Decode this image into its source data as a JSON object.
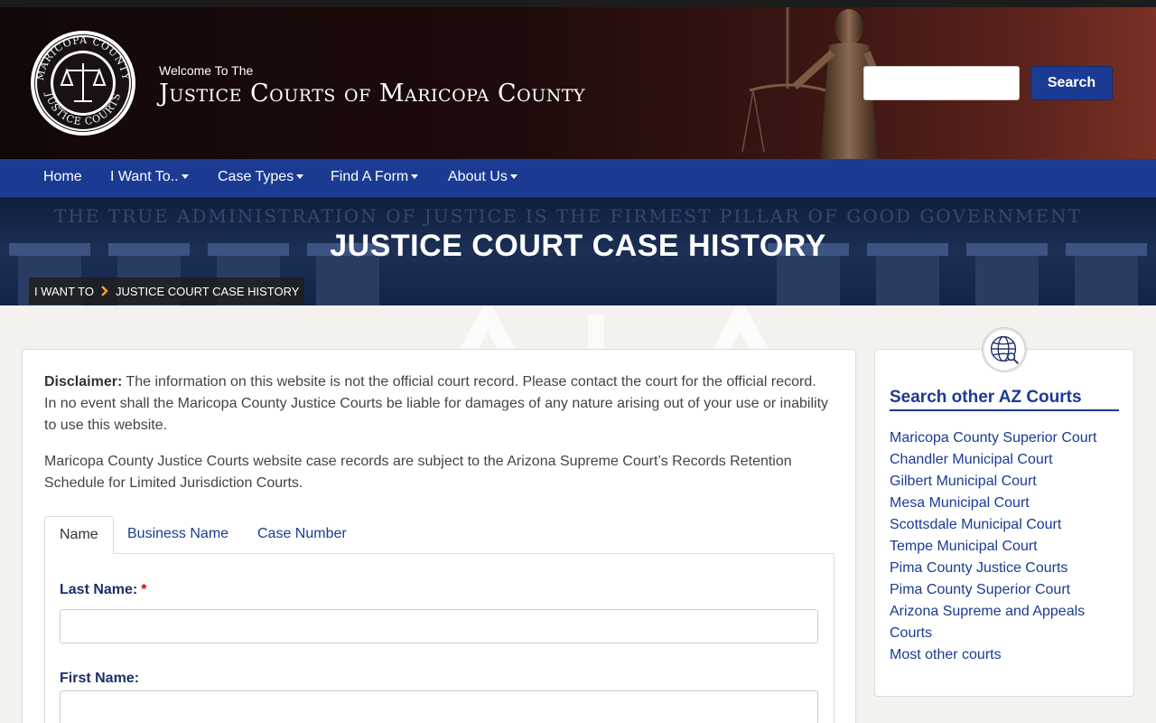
{
  "header": {
    "welcome": "Welcome To The",
    "title": "Justice Courts of Maricopa County",
    "logo_text_top": "MARICOPA COUNTY",
    "logo_text_bottom": "JUSTICE COURTS",
    "search_placeholder": "",
    "search_button": "Search"
  },
  "nav": {
    "items": [
      {
        "label": "Home",
        "has_dropdown": false
      },
      {
        "label": "I Want To..",
        "has_dropdown": true
      },
      {
        "label": "Case Types",
        "has_dropdown": true
      },
      {
        "label": "Find A Form",
        "has_dropdown": true
      },
      {
        "label": "About Us",
        "has_dropdown": true
      }
    ]
  },
  "banner": {
    "inscription": "THE TRUE ADMINISTRATION OF JUSTICE IS THE FIRMEST PILLAR OF GOOD GOVERNMENT",
    "heading": "JUSTICE COURT CASE HISTORY",
    "breadcrumb": [
      "I WANT TO",
      "JUSTICE COURT CASE HISTORY"
    ]
  },
  "main": {
    "disclaimer_label": "Disclaimer:",
    "disclaimer_text": " The information on this website is not the official court record. Please contact the court for the official record. In no event shall the Maricopa County Justice Courts be liable for damages of any nature arising out of your use or inability to use this website.",
    "retention_text": "Maricopa County Justice Courts website case records are subject to the Arizona Supreme Court’s Records Retention Schedule for Limited Jurisdiction Courts.",
    "tabs": [
      "Name",
      "Business Name",
      "Case Number"
    ],
    "active_tab": "Name",
    "fields": {
      "last_name_label": "Last Name:",
      "required_mark": "*",
      "last_name_value": "",
      "first_name_label": "First Name:",
      "first_name_value": ""
    }
  },
  "sidebar": {
    "title": "Search other AZ Courts",
    "links": [
      "Maricopa County Superior Court",
      "Chandler Municipal Court",
      "Gilbert Municipal Court",
      "Mesa Municipal Court",
      "Scottsdale Municipal Court",
      "Tempe Municipal Court",
      "Pima County Justice Courts",
      "Pima County Superior Court",
      "Arizona Supreme and Appeals Courts",
      "Most other courts"
    ]
  },
  "colors": {
    "nav_blue": "#1b3b93",
    "header_dark": "#1e0b0b",
    "breadcrumb_accent": "#f0a030",
    "required": "#cc0000"
  }
}
